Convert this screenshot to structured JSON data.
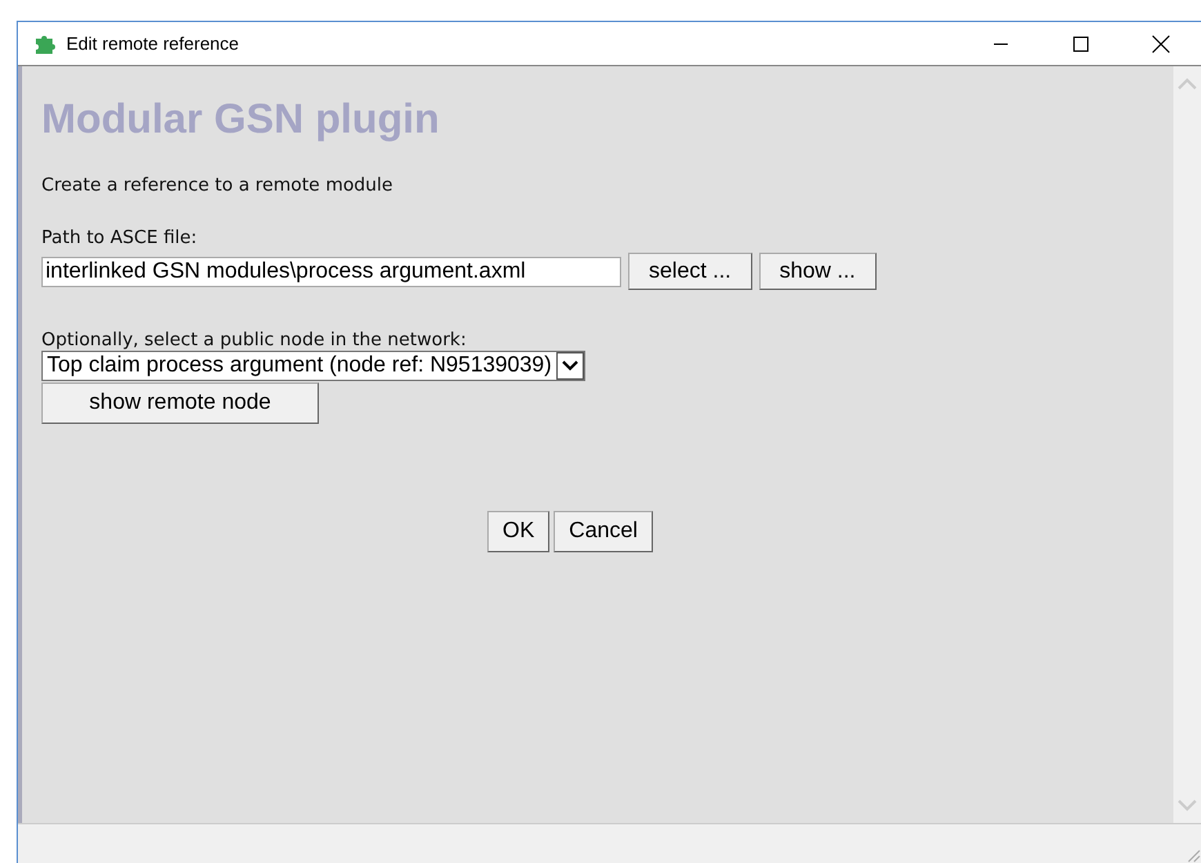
{
  "window": {
    "title": "Edit remote reference"
  },
  "heading": "Modular GSN plugin",
  "description": "Create a reference to a remote module",
  "path": {
    "label": "Path to ASCE file:",
    "value": "interlinked GSN modules\\process argument.axml",
    "buttons": [
      "select ...",
      "show ..."
    ]
  },
  "node": {
    "label": "Optionally, select a public node in the network:",
    "value": "Top claim process argument (node ref: N95139039)",
    "button": "show remote node"
  },
  "dialog_buttons": [
    "OK",
    "Cancel"
  ]
}
